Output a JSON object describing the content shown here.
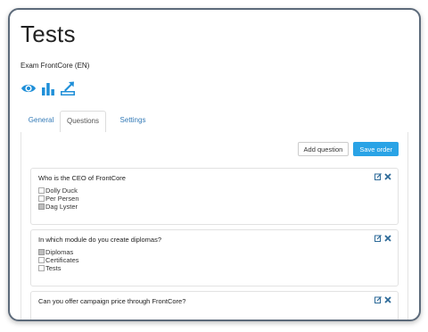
{
  "page": {
    "title": "Tests",
    "exam_name": "Exam FrontCore (EN)"
  },
  "action_icons": [
    "eye-icon",
    "bar-chart-icon",
    "export-icon"
  ],
  "tabs": [
    {
      "label": "General",
      "active": false
    },
    {
      "label": "Questions",
      "active": true
    },
    {
      "label": "Settings",
      "active": false
    }
  ],
  "toolbar": {
    "add_label": "Add question",
    "save_label": "Save order"
  },
  "questions": [
    {
      "text": "Who is the CEO of FrontCore",
      "answers": [
        {
          "label": "Dolly Duck",
          "correct": false
        },
        {
          "label": "Per Persen",
          "correct": false
        },
        {
          "label": "Dag Lyster",
          "correct": true
        }
      ]
    },
    {
      "text": "In which module do you create diplomas?",
      "answers": [
        {
          "label": "Diplomas",
          "correct": true
        },
        {
          "label": "Certificates",
          "correct": false
        },
        {
          "label": "Tests",
          "correct": false
        }
      ]
    },
    {
      "text": "Can you offer campaign price through FrontCore?",
      "answers": []
    }
  ],
  "colors": {
    "accent": "#2aa3e6",
    "link": "#337ab7",
    "frame": "#5c6a7a",
    "delete": "#2d6a98"
  }
}
